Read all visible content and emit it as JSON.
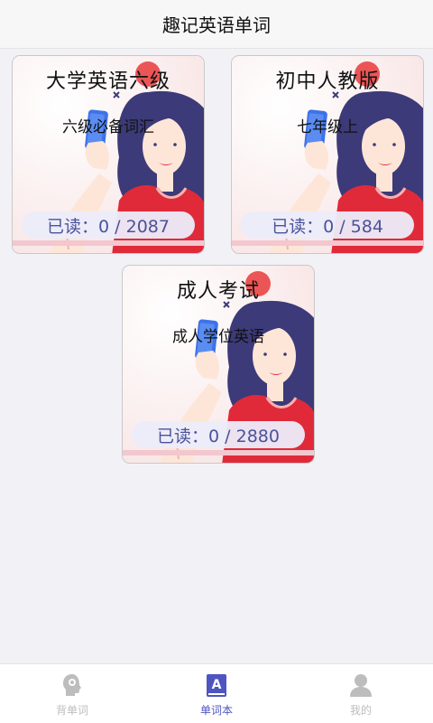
{
  "header": {
    "title": "趣记英语单词"
  },
  "books": [
    {
      "title": "大学英语六级",
      "subtitle": "六级必备词汇",
      "progress": "已读：0 / 2087",
      "read": 0,
      "total": 2087
    },
    {
      "title": "初中人教版",
      "subtitle": "七年级上",
      "progress": "已读：0 / 584",
      "read": 0,
      "total": 584
    },
    {
      "title": "成人考试",
      "subtitle": "成人学位英语",
      "progress": "已读：0 / 2880",
      "read": 0,
      "total": 2880
    }
  ],
  "tabbar": {
    "tabs": [
      {
        "label": "背单词",
        "icon": "head-icon",
        "active": false
      },
      {
        "label": "单词本",
        "icon": "book-icon",
        "active": true
      },
      {
        "label": "我的",
        "icon": "user-icon",
        "active": false
      }
    ]
  },
  "colors": {
    "accent": "#4e55c0",
    "inactive": "#bdbdbd",
    "progress_text": "#4a5399",
    "shirt": "#e02a3a",
    "hair": "#3c3a78",
    "phone": "#3d72e8"
  }
}
